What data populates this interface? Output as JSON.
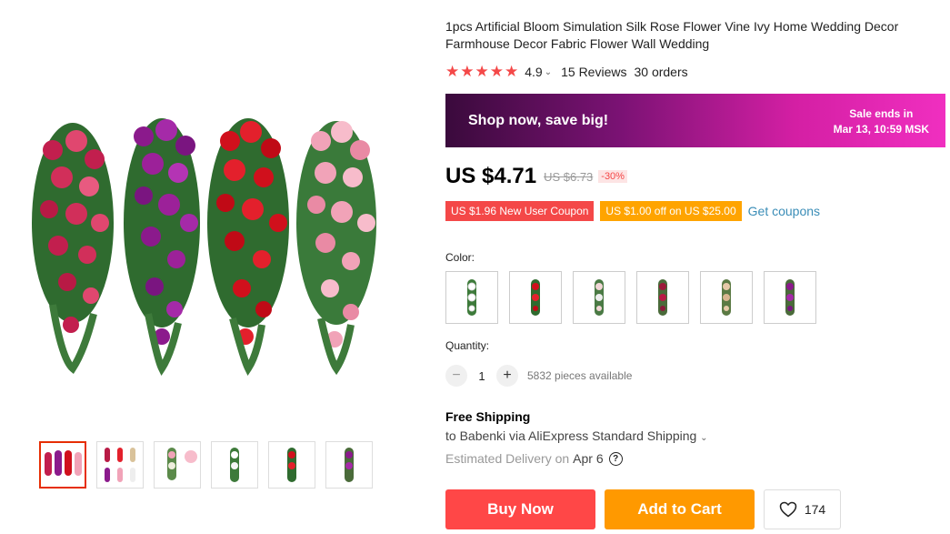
{
  "product": {
    "title": "1pcs Artificial Bloom Simulation Silk Rose Flower Vine Ivy Home Wedding Decor Farmhouse Decor Fabric Flower Wall Wedding",
    "rating": {
      "stars": 5,
      "score": "4.9",
      "reviews": "15 Reviews",
      "orders": "30 orders"
    },
    "icons": {
      "star": "star-icon",
      "chevron": "chevron-down-icon",
      "heart": "heart-icon",
      "help": "question-circle-icon"
    }
  },
  "banner": {
    "promo": "Shop now, save big!",
    "sale_line1": "Sale ends in",
    "sale_line2": "Mar 13, 10:59 MSK"
  },
  "price": {
    "current": "US $4.71",
    "original": "US $6.73",
    "discount": "-30%"
  },
  "coupons": {
    "new_user": "US $1.96 New User Coupon",
    "store": "US $1.00 off on US $25.00",
    "get": "Get coupons"
  },
  "color": {
    "label": "Color:",
    "options": [
      "white",
      "red",
      "pink",
      "burgundy",
      "champagne",
      "purple"
    ]
  },
  "quantity": {
    "label": "Quantity:",
    "value": "1",
    "available": "5832 pieces available",
    "minus": "−",
    "plus": "+"
  },
  "shipping": {
    "title": "Free Shipping",
    "line": "to Babenki via AliExpress Standard Shipping",
    "delivery_label": "Estimated Delivery on",
    "delivery_date": "Apr 6",
    "help": "?"
  },
  "actions": {
    "buy_now": "Buy Now",
    "add_to_cart": "Add to Cart",
    "wishlist_count": "174"
  },
  "colors": {
    "accent_red": "#ff4747",
    "accent_orange": "#ff9900",
    "star": "#f44848",
    "link": "#3a8db7"
  }
}
